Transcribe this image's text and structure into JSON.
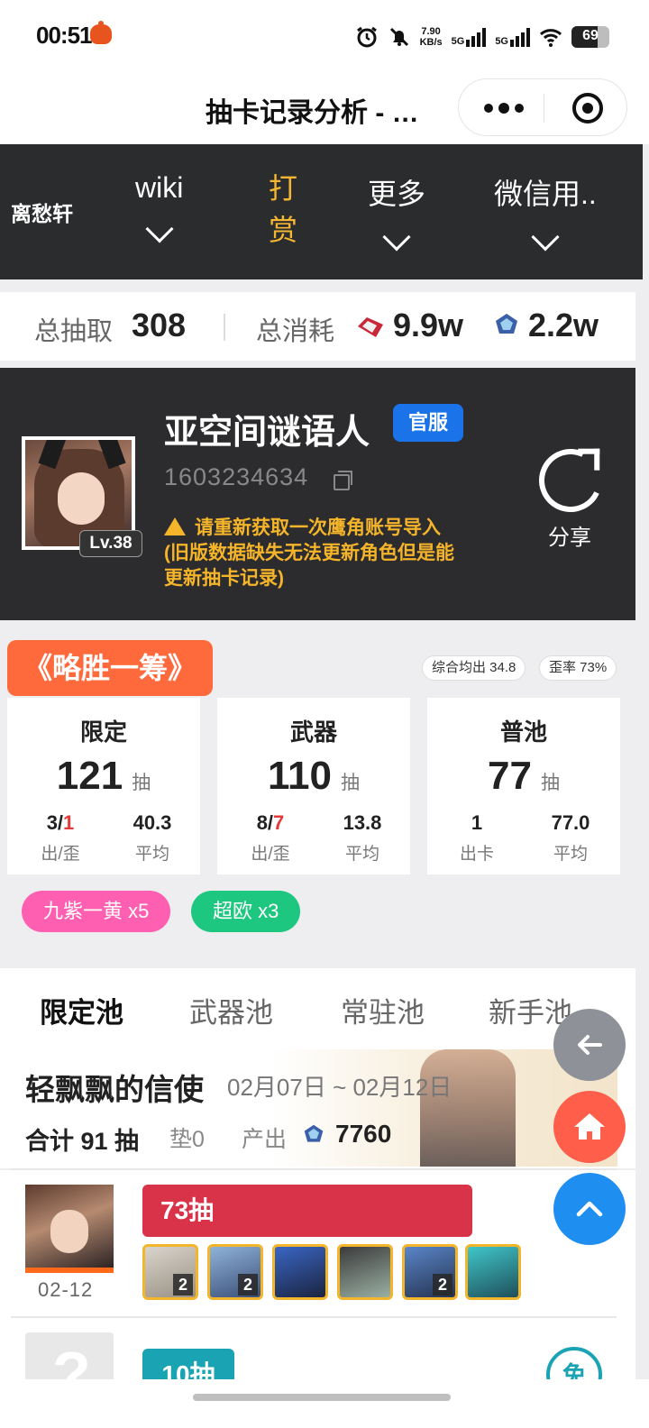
{
  "status_bar": {
    "time": "00:51",
    "net_speed": "7.90",
    "net_speed_unit": "KB/s",
    "sim1": "5G",
    "sim2": "5G",
    "battery": "69"
  },
  "title_bar": {
    "title": "抽卡记录分析 - …"
  },
  "nav": {
    "brand": "离愁轩",
    "items": [
      {
        "label": "wiki"
      },
      {
        "label": "打赏"
      },
      {
        "label": "更多"
      },
      {
        "label": "微信用.."
      }
    ]
  },
  "summary": {
    "total_label": "总抽取",
    "total_value": "308",
    "cost_label": "总消耗",
    "cost_red": "9.9w",
    "cost_blue": "2.2w"
  },
  "profile": {
    "name": "亚空间谜语人",
    "server": "官服",
    "uid": "1603234634",
    "level": "Lv.38",
    "warning_line1": "请重新获取一次鹰角账号导入",
    "warning_line2": "(旧版数据缺失无法更新角色但是能",
    "warning_line3": "更新抽卡记录)",
    "share_label": "分享"
  },
  "luck": {
    "tag": "《略胜一筹》",
    "avg_label": "综合均出 34.8",
    "skew_label": "歪率 73%"
  },
  "stats": [
    {
      "title": "限定",
      "count": "121",
      "unit": "抽",
      "left_a": "3/",
      "left_b": "1",
      "left_caption": "出/歪",
      "right_value": "40.3",
      "right_caption": "平均"
    },
    {
      "title": "武器",
      "count": "110",
      "unit": "抽",
      "left_a": "8/",
      "left_b": "7",
      "left_caption": "出/歪",
      "right_value": "13.8",
      "right_caption": "平均"
    },
    {
      "title": "普池",
      "count": "77",
      "unit": "抽",
      "left_a": "1",
      "left_b": "",
      "left_caption": "出卡",
      "right_value": "77.0",
      "right_caption": "平均"
    }
  ],
  "chips": [
    {
      "label": "九紫一黄 x5",
      "color": "#ff5fb0"
    },
    {
      "label": "超欧 x3",
      "color": "#1ec77f"
    }
  ],
  "tabs": [
    {
      "label": "限定池"
    },
    {
      "label": "武器池"
    },
    {
      "label": "常驻池"
    },
    {
      "label": "新手池"
    }
  ],
  "banner": {
    "name": "轻飘飘的信使",
    "date": "02月07日 ~ 02月12日",
    "total": "合计 91 抽",
    "pad": "垫0",
    "output_label": "产出",
    "output_value": "7760"
  },
  "records": [
    {
      "date": "02-12",
      "pulls": "73抽",
      "items": [
        {
          "count": "2"
        },
        {
          "count": "2"
        },
        {
          "count": ""
        },
        {
          "count": ""
        },
        {
          "count": "2"
        },
        {
          "count": ""
        }
      ]
    },
    {
      "pulls": "10抽",
      "badge": "免"
    }
  ],
  "colors": {
    "accent_orange": "#ff6a3c",
    "nav_bg": "#2b2c2e",
    "gold": "#f5b731",
    "server_blue": "#1a73e8",
    "pull_red": "#d9334a",
    "pull_teal": "#1aa3b3"
  }
}
